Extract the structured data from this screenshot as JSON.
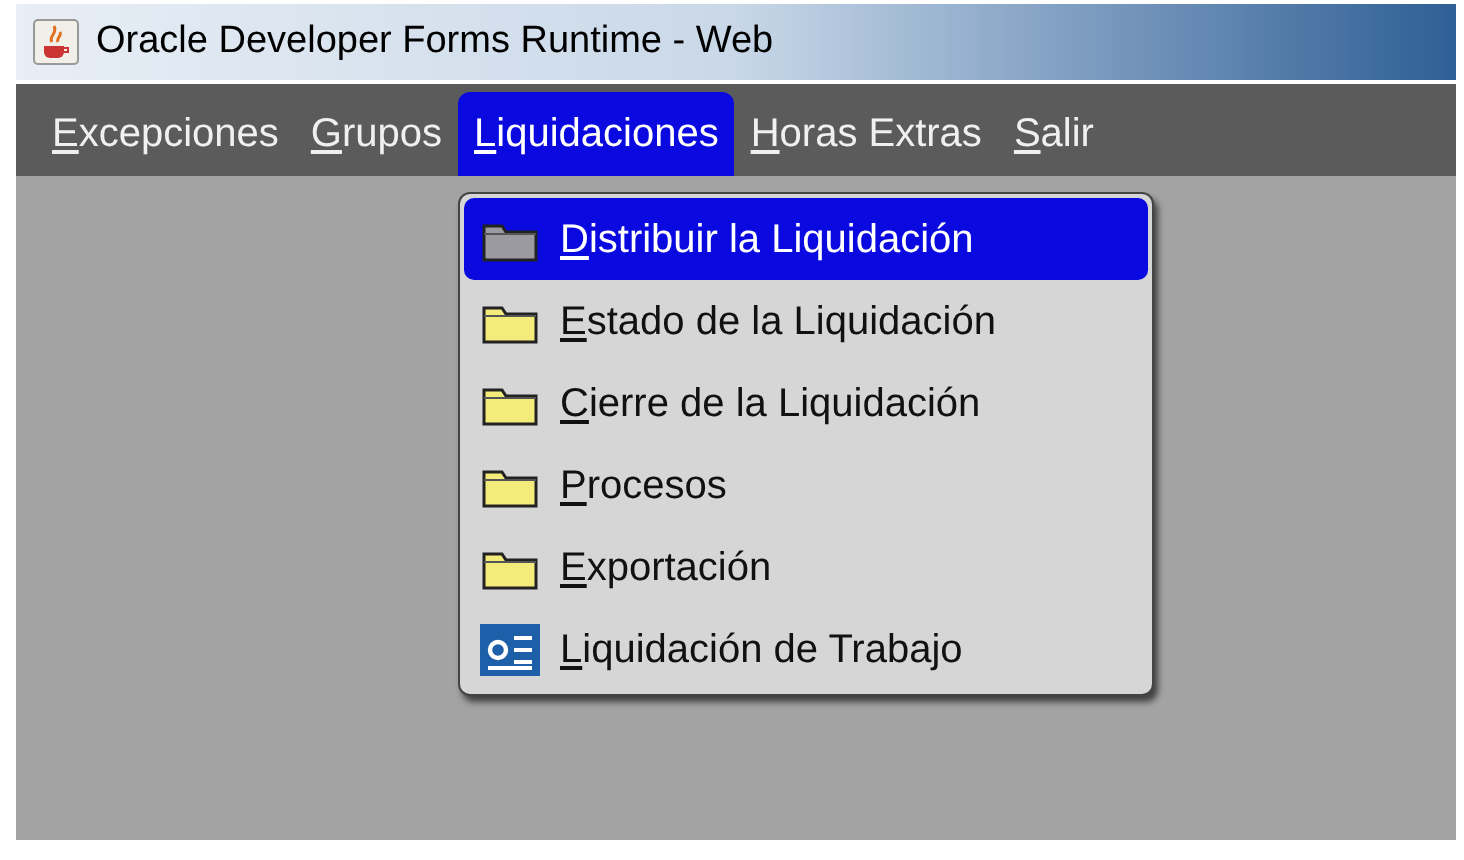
{
  "window": {
    "title": "Oracle Developer Forms Runtime - Web"
  },
  "menu_bar": [
    {
      "label": "Excepciones",
      "selected": false
    },
    {
      "label": "Grupos",
      "selected": false
    },
    {
      "label": "Liquidaciones",
      "selected": true
    },
    {
      "label": "Horas Extras",
      "selected": false
    },
    {
      "label": "Salir",
      "selected": false
    }
  ],
  "dropdown": {
    "items": [
      {
        "label": "Distribuir la Liquidación",
        "kind": "folder",
        "selected": true
      },
      {
        "label": "Estado de la Liquidación",
        "kind": "folder",
        "selected": false
      },
      {
        "label": "Cierre de la Liquidación",
        "kind": "folder",
        "selected": false
      },
      {
        "label": "Procesos",
        "kind": "folder",
        "selected": false
      },
      {
        "label": "Exportación",
        "kind": "folder",
        "selected": false
      },
      {
        "label": "Liquidación de Trabajo",
        "kind": "document",
        "selected": false
      }
    ]
  }
}
